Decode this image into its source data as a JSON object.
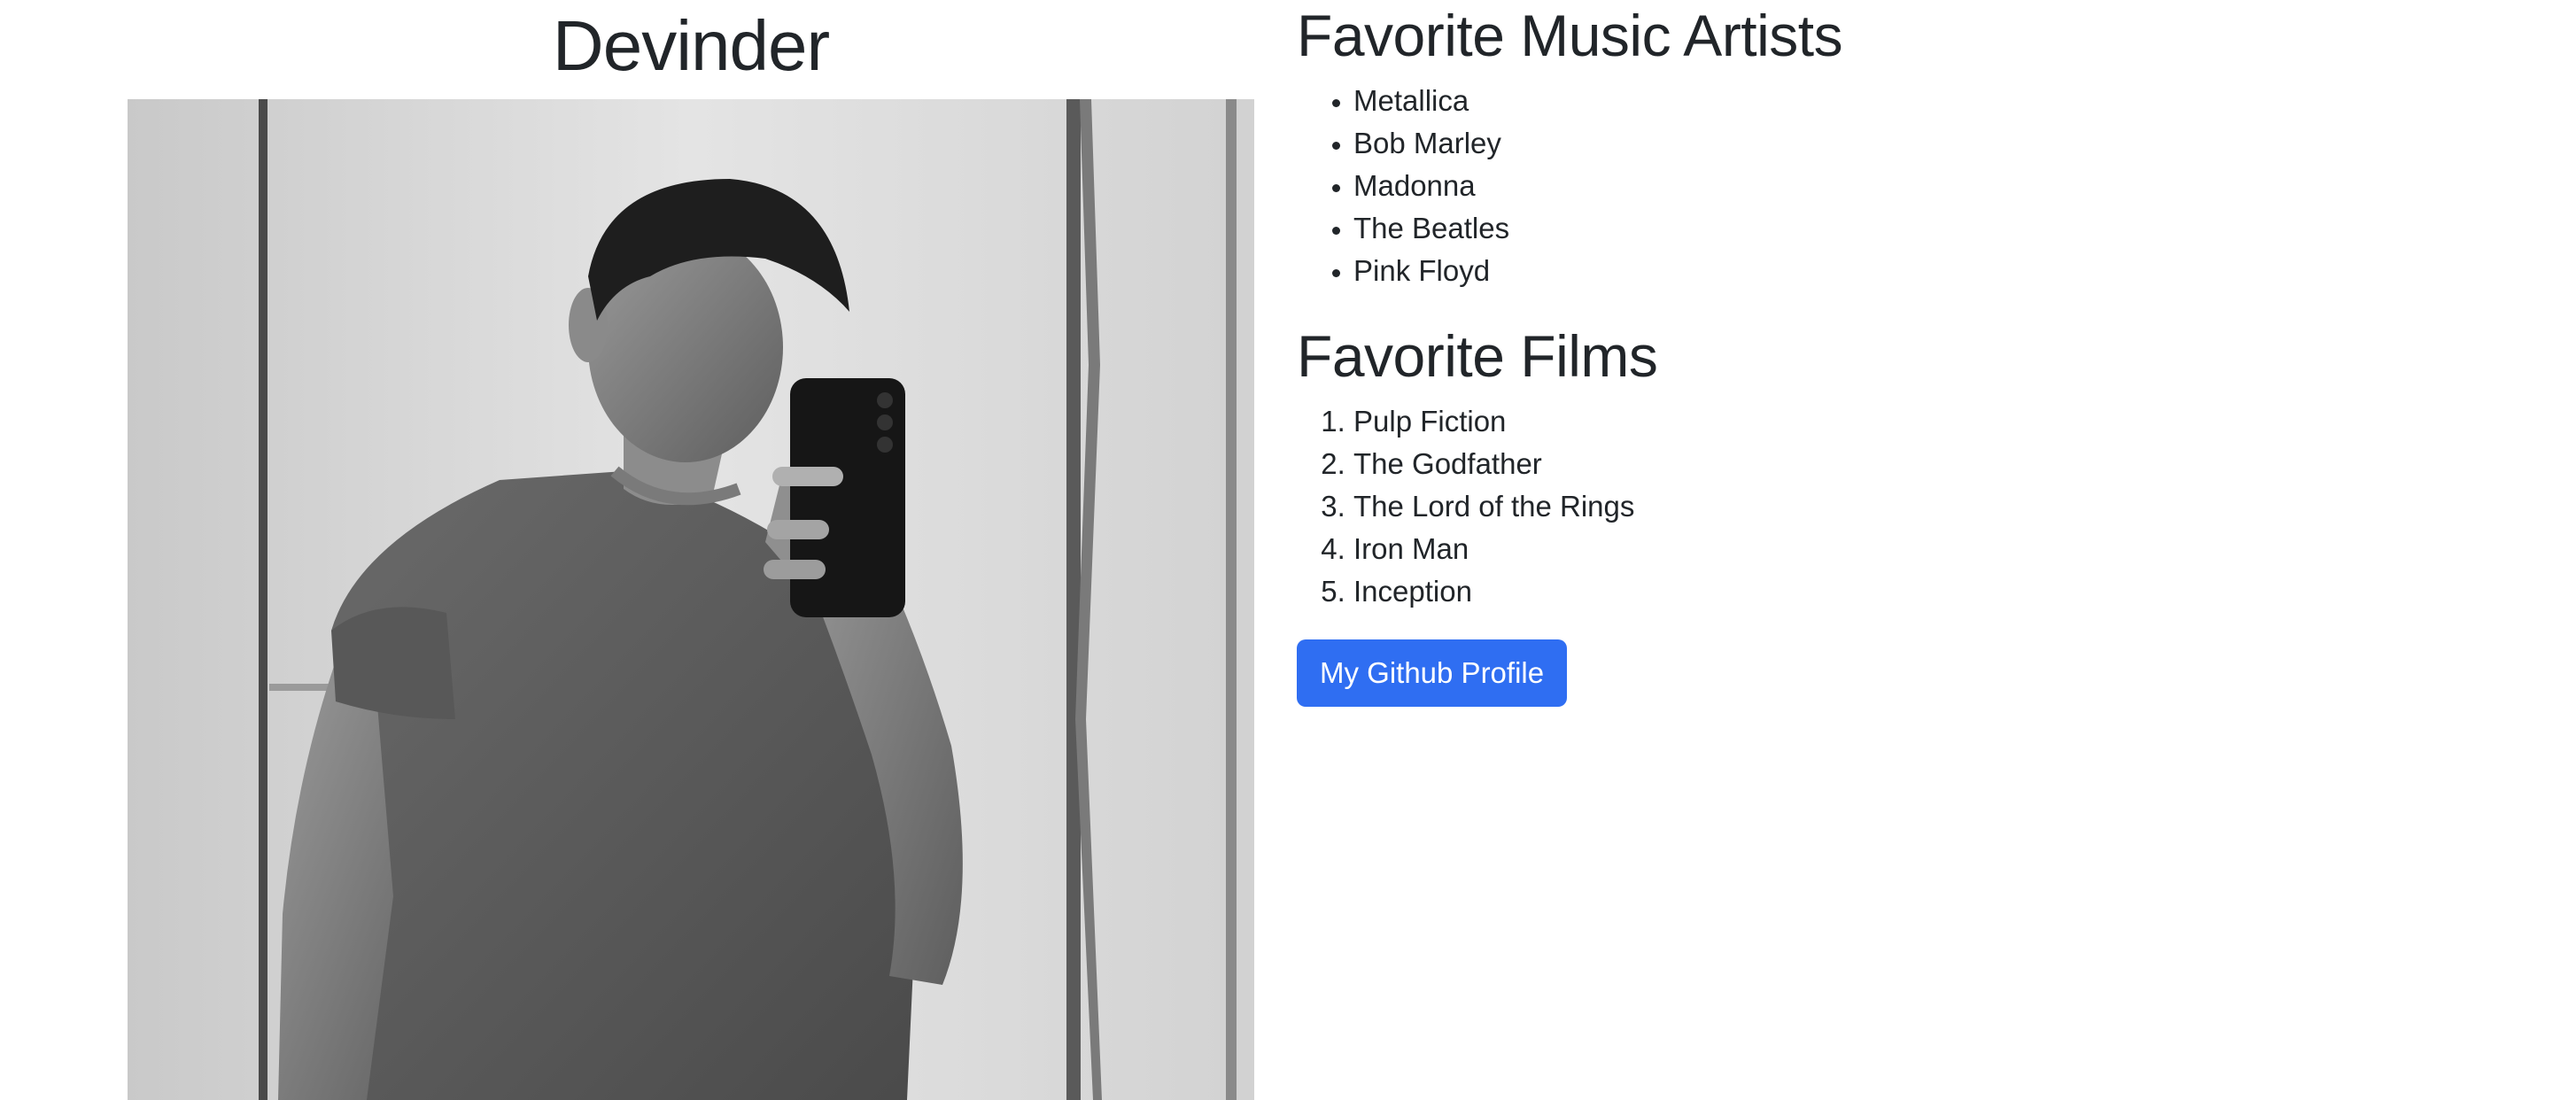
{
  "profile": {
    "name": "Devinder"
  },
  "music": {
    "title": "Favorite Music Artists",
    "items": [
      "Metallica",
      "Bob Marley",
      "Madonna",
      "The Beatles",
      "Pink Floyd"
    ]
  },
  "films": {
    "title": "Favorite Films",
    "items": [
      "Pulp Fiction",
      "The Godfather",
      "The Lord of the Rings",
      "Iron Man",
      "Inception"
    ]
  },
  "github": {
    "label": "My Github Profile"
  },
  "colors": {
    "button": "#2f6ef2",
    "text": "#212529"
  }
}
